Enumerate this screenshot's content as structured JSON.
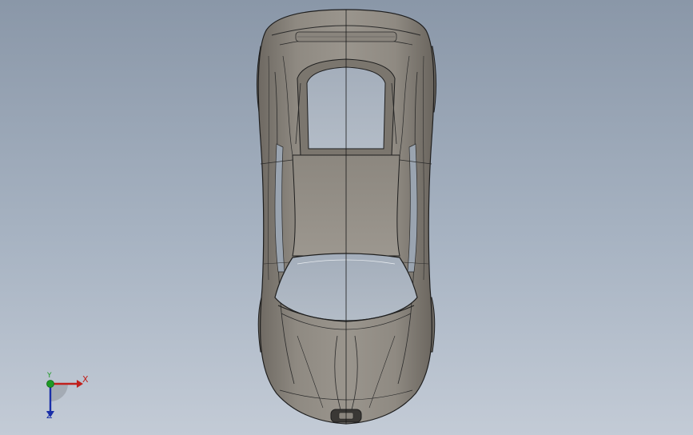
{
  "viewport": {
    "background_top": "#8a97a8",
    "background_bottom": "#c3cbd6",
    "model_color": "#8b857d",
    "glass_color": "#aab4c0"
  },
  "triad": {
    "x_label": "X",
    "y_label": "Y",
    "z_label": "Z",
    "x_color": "#c0201c",
    "y_color": "#1d9a24",
    "z_color": "#1a2fa8"
  }
}
